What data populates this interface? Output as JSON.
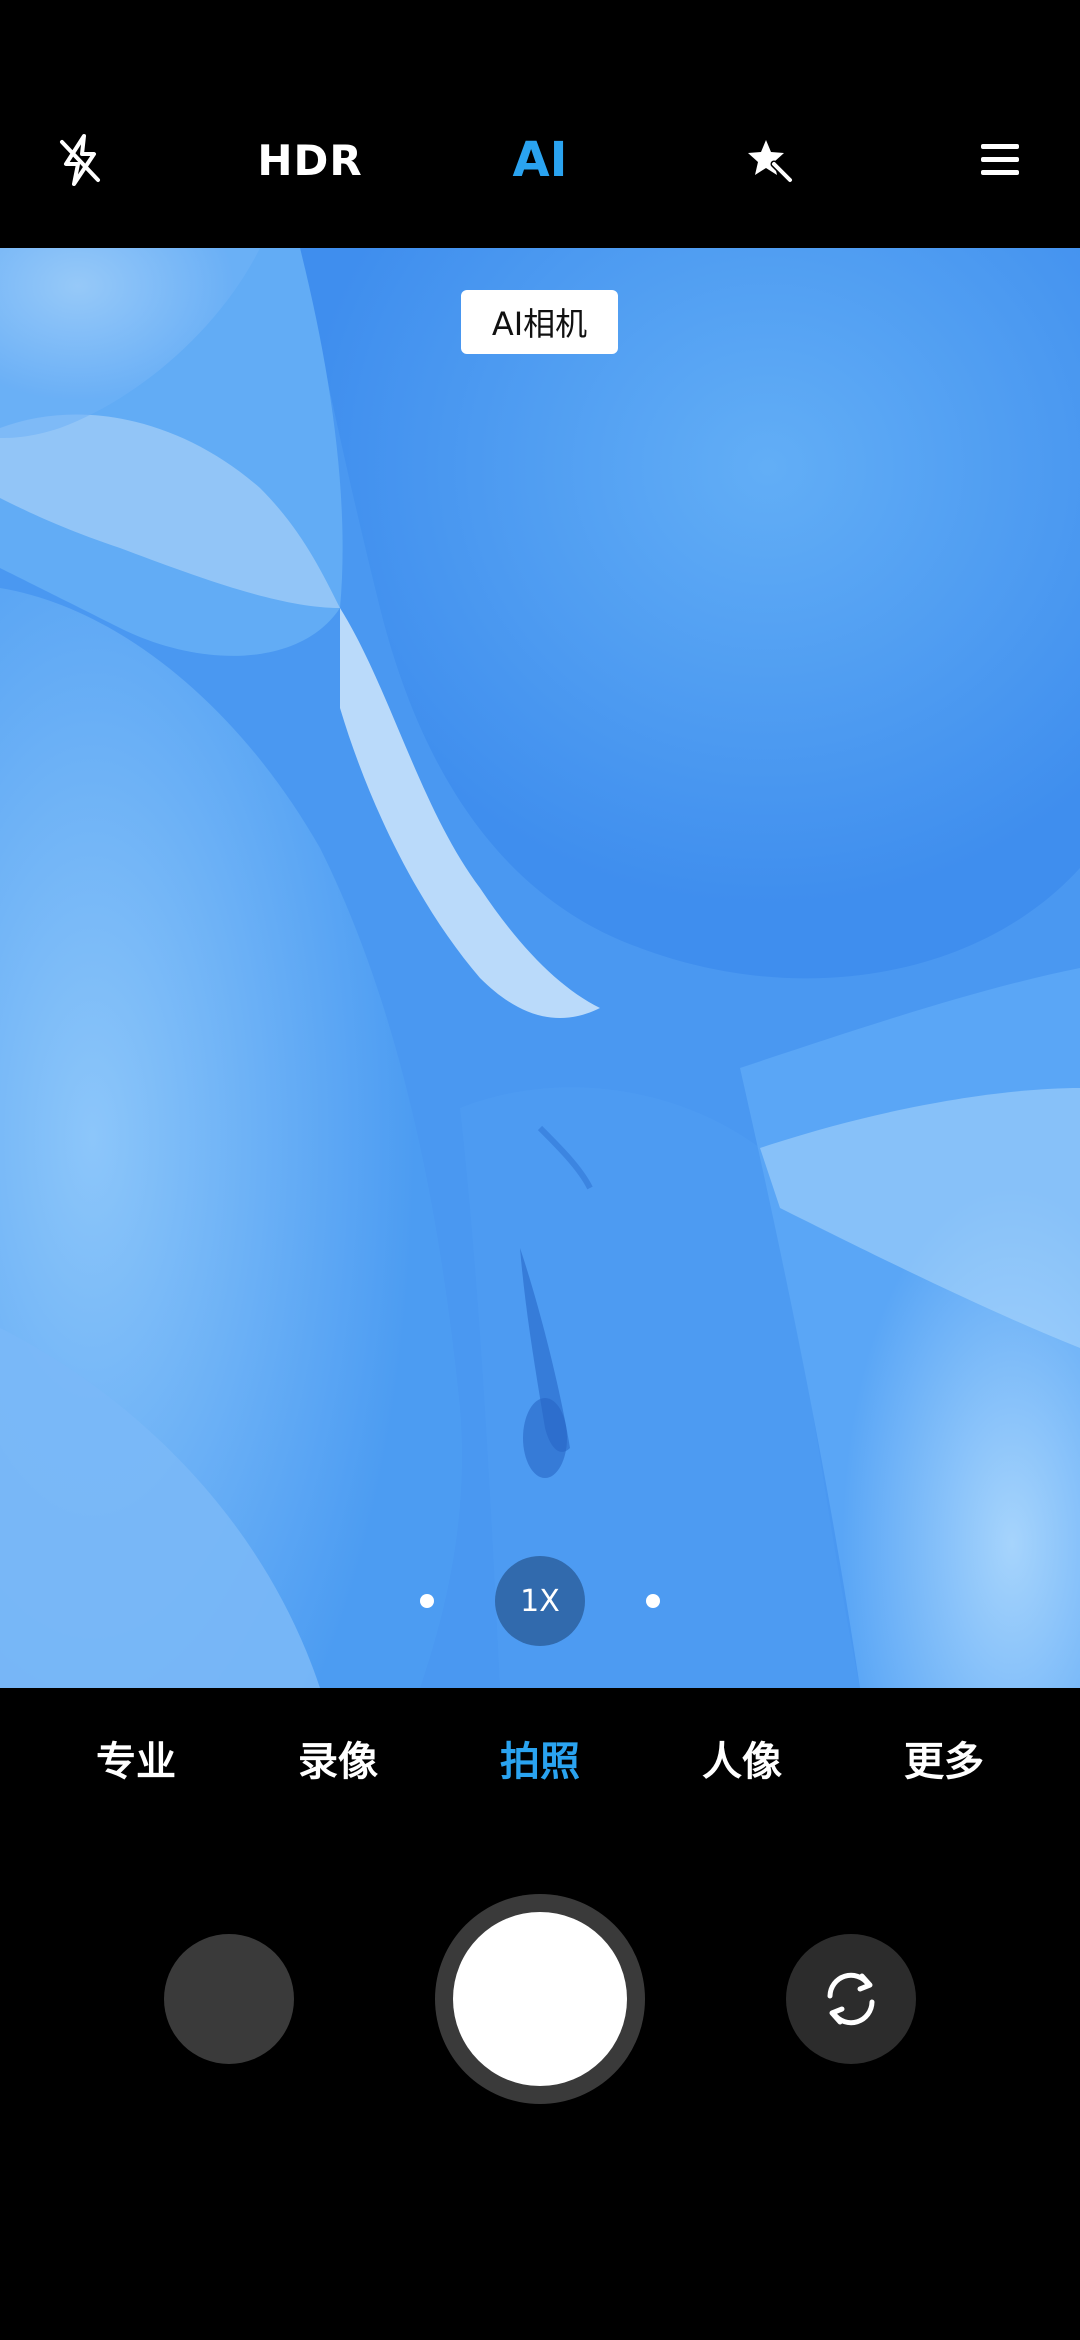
{
  "topbar": {
    "flash_icon": "flash-off-icon",
    "hdr_label": "HDR",
    "ai_label": "AI",
    "filter_icon": "magic-star-icon",
    "menu_icon": "menu-icon"
  },
  "viewfinder": {
    "ai_badge": "AI相机",
    "zoom_label": "1X"
  },
  "modes": {
    "items": [
      "专业",
      "录像",
      "拍照",
      "人像",
      "更多"
    ],
    "active": "拍照"
  },
  "bottom": {
    "gallery_icon": "gallery-thumbnail",
    "shutter_icon": "shutter-button",
    "switch_icon": "switch-camera-icon"
  },
  "colors": {
    "accent": "#2aa3f0",
    "background": "#000000",
    "viewfinder_blue": "#4e9bf2"
  }
}
